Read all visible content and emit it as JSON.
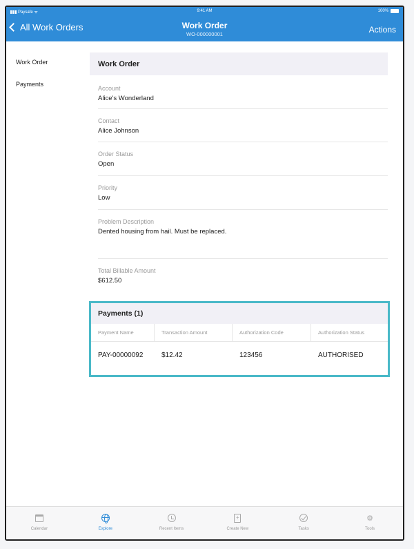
{
  "status_bar": {
    "carrier": "Paysafe",
    "time": "9:41 AM",
    "battery": "100%"
  },
  "nav": {
    "back_label": "All Work Orders",
    "title": "Work Order",
    "subtitle": "WO-000000001",
    "actions_label": "Actions"
  },
  "sidebar": {
    "items": [
      {
        "label": "Work Order"
      },
      {
        "label": "Payments"
      }
    ]
  },
  "work_order": {
    "header": "Work Order",
    "fields": [
      {
        "label": "Account",
        "value": "Alice's Wonderland"
      },
      {
        "label": "Contact",
        "value": "Alice Johnson"
      },
      {
        "label": "Order Status",
        "value": "Open"
      },
      {
        "label": "Priority",
        "value": "Low"
      },
      {
        "label": "Problem Description",
        "value": "Dented housing from hail. Must be replaced."
      },
      {
        "label": "Total Billable Amount",
        "value": "$612.50"
      }
    ]
  },
  "payments": {
    "header": "Payments (1)",
    "columns": [
      "Payment Name",
      "Transaction Amount",
      "Authorization Code",
      "Authorization Status"
    ],
    "rows": [
      [
        "PAY-00000092",
        "$12.42",
        "123456",
        "AUTHORISED"
      ]
    ]
  },
  "tabbar": {
    "items": [
      {
        "label": "Calendar",
        "icon": "calendar-icon"
      },
      {
        "label": "Explore",
        "icon": "globe-icon"
      },
      {
        "label": "Recent Items",
        "icon": "clock-icon"
      },
      {
        "label": "Create New",
        "icon": "create-new-icon"
      },
      {
        "label": "Tasks",
        "icon": "check-circle-icon"
      },
      {
        "label": "Tools",
        "icon": "gear-icon"
      }
    ],
    "active_index": 1
  },
  "colors": {
    "brand": "#2f8cd8",
    "highlight_border": "#4ab9c8",
    "section_header_bg": "#f1f0f6"
  }
}
